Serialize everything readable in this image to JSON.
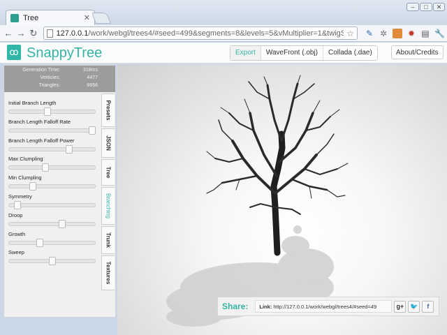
{
  "browser": {
    "tab_title": "Tree",
    "url_host": "127.0.0.1",
    "url_path": "/work/webgl/trees4/#seed=499&segments=8&levels=5&vMultiplier=1&twigScale="
  },
  "header": {
    "brand": "SnappyTree",
    "export_buttons": [
      "Export",
      "WaveFront (.obj)",
      "Collada (.dae)"
    ],
    "about": "About/Credits"
  },
  "stats": [
    {
      "label": "Generation Time:",
      "value": "318ms"
    },
    {
      "label": "Verticies:",
      "value": "4477"
    },
    {
      "label": "Triangles:",
      "value": "6656"
    }
  ],
  "controls": [
    {
      "label": "Initial Branch Length",
      "level": 0.45
    },
    {
      "label": "Branch Length Falloff Rate",
      "level": 0.97
    },
    {
      "label": "Branch Length Falloff Power",
      "level": 0.7
    },
    {
      "label": "Max Clumpling",
      "level": 0.42
    },
    {
      "label": "Min Clumpling",
      "level": 0.28
    },
    {
      "label": "Symmetry",
      "level": 0.1
    },
    {
      "label": "Droop",
      "level": 0.62
    },
    {
      "label": "Growth",
      "level": 0.36
    },
    {
      "label": "Sweep",
      "level": 0.5
    }
  ],
  "side_tabs": [
    {
      "label": "Presets",
      "active": false
    },
    {
      "label": "JSON",
      "active": false
    },
    {
      "label": "Tree",
      "active": false
    },
    {
      "label": "Branching",
      "active": true
    },
    {
      "label": "Trunk",
      "active": false
    },
    {
      "label": "Textures",
      "active": false
    }
  ],
  "share": {
    "label": "Share:",
    "link_label": "Link:",
    "link_url": "http://127.0.0.1/work/webgl/trees4/#seed=49",
    "icons": [
      "g+",
      "twitter",
      "f"
    ]
  },
  "colors": {
    "accent": "#36b3a5"
  }
}
